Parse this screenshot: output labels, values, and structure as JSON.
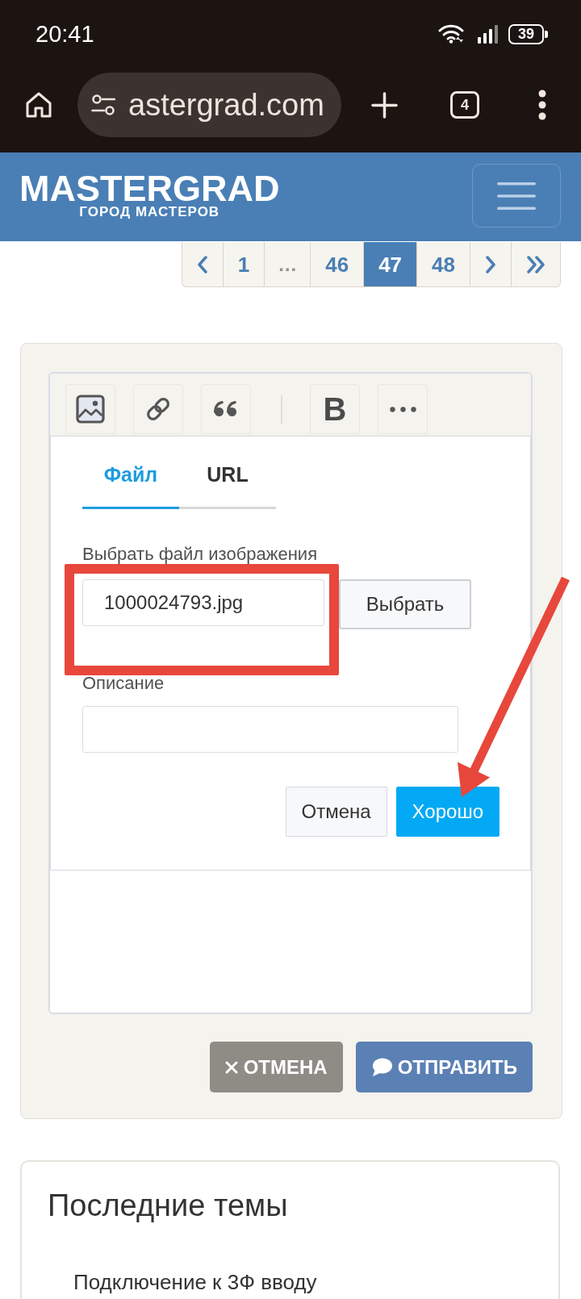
{
  "status_bar": {
    "time": "20:41",
    "battery": "39"
  },
  "browser": {
    "url": "astergrad.com",
    "tab_count": "4"
  },
  "site_header": {
    "logo": "MASTERGRAD",
    "tagline": "ГОРОД МАСТЕРОВ"
  },
  "pagination": [
    {
      "kind": "prev",
      "selected": false
    },
    {
      "kind": "page",
      "label": "1",
      "selected": false
    },
    {
      "kind": "ellipsis",
      "label": "…",
      "selected": false
    },
    {
      "kind": "page",
      "label": "46",
      "selected": false
    },
    {
      "kind": "page",
      "label": "47",
      "selected": true
    },
    {
      "kind": "page",
      "label": "48",
      "selected": false
    },
    {
      "kind": "next",
      "selected": false
    },
    {
      "kind": "last",
      "selected": false
    }
  ],
  "editor": {
    "toolbar": [
      {
        "kind": "image"
      },
      {
        "kind": "link"
      },
      {
        "kind": "quote"
      },
      {
        "kind": "separator"
      },
      {
        "kind": "bold",
        "label": "B"
      },
      {
        "kind": "more"
      }
    ],
    "dialog": {
      "tabs": [
        {
          "label": "Файл",
          "selected": true
        },
        {
          "label": "URL",
          "selected": false
        }
      ],
      "file_label": "Выбрать файл изображения",
      "file_name": "1000024793.jpg",
      "choose_button": "Выбрать",
      "description_label": "Описание",
      "buttons": [
        {
          "kind": "secondary",
          "label": "Отмена"
        },
        {
          "kind": "primary",
          "label": "Хорошо"
        }
      ]
    }
  },
  "form_buttons": [
    {
      "kind": "cancel",
      "label": "ОТМЕНА"
    },
    {
      "kind": "submit",
      "label": "ОТПРАВИТЬ"
    }
  ],
  "latest_topics": {
    "title": "Последние темы",
    "items": [
      {
        "label": "Подключение к 3Ф вводу"
      }
    ]
  },
  "annotations": [
    {
      "kind": "highlight_box"
    },
    {
      "kind": "arrow"
    }
  ]
}
